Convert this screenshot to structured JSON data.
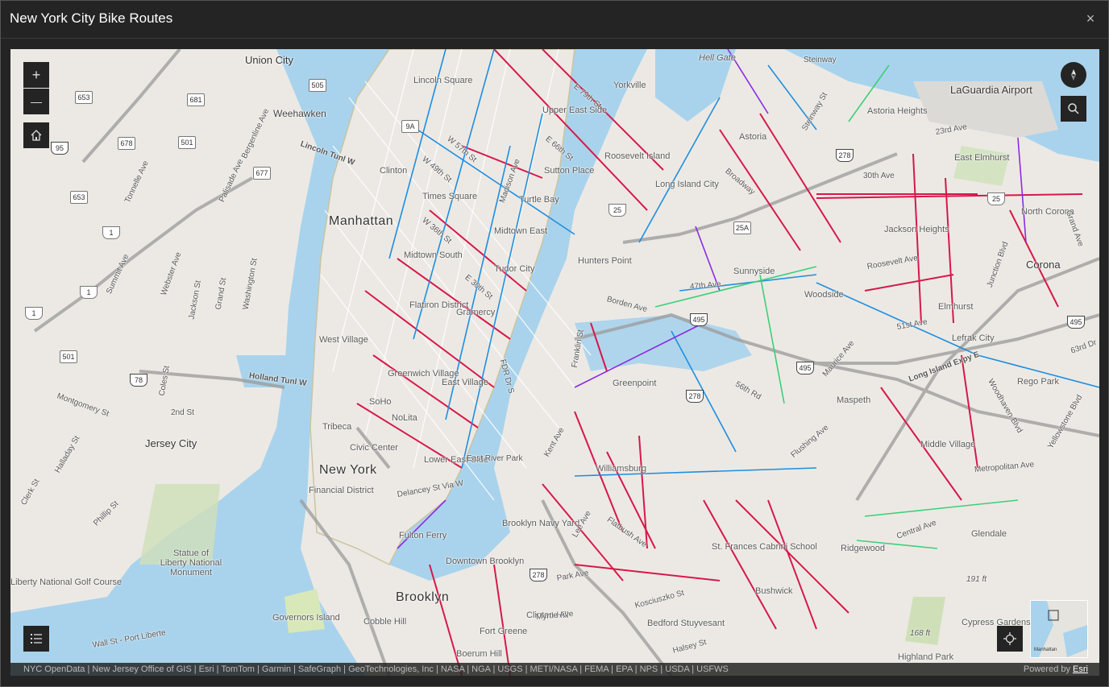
{
  "window": {
    "title": "New York City Bike Routes"
  },
  "controls": {
    "zoom_in": "+",
    "zoom_out": "—",
    "close": "×"
  },
  "labels": {
    "boroughs": [
      "Manhattan",
      "New York",
      "Brooklyn",
      "Jersey City"
    ],
    "neighborhoods": [
      "Union City",
      "Weehawken",
      "Lincoln Square",
      "Yorkville",
      "Upper East Side",
      "Clinton",
      "Times Square",
      "Turtle Bay",
      "Sutton Place",
      "Midtown East",
      "Midtown South",
      "Tudor City",
      "Roosevelt Island",
      "Long Island City",
      "Hunters Point",
      "Astoria",
      "Astoria Heights",
      "LaGuardia Airport",
      "East Elmhurst",
      "Jackson Heights",
      "North Corona",
      "Corona",
      "Sunnyside",
      "Woodside",
      "Elmhurst",
      "Lefrak City",
      "Rego Park",
      "Maspeth",
      "Middle Village",
      "Glendale",
      "Ridgewood",
      "Bushwick",
      "Williamsburg",
      "Greenpoint",
      "Flatiron District",
      "Gramercy",
      "West Village",
      "Greenwich Village",
      "East Village",
      "SoHo",
      "NoLita",
      "Tribeca",
      "Civic Center",
      "Lower East Side",
      "Financial District",
      "Downtown Brooklyn",
      "Brooklyn Navy Yard",
      "Fulton Ferry",
      "Cobble Hill",
      "Fort Greene",
      "Clinton Hill",
      "Boerum Hill",
      "Bedford Stuyvesant",
      "St. Frances Cabrini School",
      "Cypress Gardens",
      "Highland Park",
      "Statue of Liberty National Monument",
      "Liberty National Golf Course",
      "Governors Island",
      "Hell Gate"
    ],
    "roads": [
      "Lincoln Tunl W",
      "Holland Tunl W",
      "Tonnelle Ave",
      "Palisade Ave",
      "Bergenline Ave",
      "Summit Ave",
      "Webster Ave",
      "Jackson St",
      "Grand St",
      "Washington St",
      "Montgomery St",
      "Coles St",
      "2nd St",
      "Halladay St",
      "Clerk St",
      "Phillip St",
      "Wall St - Port Liberte",
      "W 49th St",
      "W 36th St",
      "W 57th St",
      "E 79th St",
      "E 66th St",
      "E 30th St",
      "Madison Ave",
      "FDR Dr S",
      "Borden Ave",
      "47th Ave",
      "Broadway",
      "Steinway St",
      "30th Ave",
      "23rd Ave",
      "Roosevelt Ave",
      "Long Island Expy E",
      "Woodhaven Blvd",
      "Junction Blvd",
      "Metropolitan Ave",
      "Flushing Ave",
      "Kosciuszko St",
      "Myrtle Ave",
      "Halsey St",
      "Central Ave",
      "Grand Ave",
      "Maurice Ave",
      "51st Ave",
      "56th Rd",
      "Flatbush Ave",
      "Park Ave",
      "Lee Ave",
      "Kent Ave",
      "Franklin St",
      "Delancey St Via W",
      "Steinway",
      "East River Park",
      "Yellowstone Blvd",
      "63rd Dr"
    ],
    "elevation": [
      "191 ft",
      "168 ft"
    ],
    "highway_shields": [
      "495",
      "278",
      "25",
      "25A",
      "9A",
      "1",
      "95",
      "78",
      "653",
      "681",
      "505",
      "501",
      "678",
      "677"
    ]
  },
  "overview_map": {
    "label": "Manhattan"
  },
  "attribution": "NYC OpenData | New Jersey Office of GIS | Esri | TomTom | Garmin | SafeGraph | GeoTechnologies, Inc | NASA | NGA | USGS | METI/NASA | FEMA | EPA | NPS | USDA | USFWS",
  "powered_by": {
    "prefix": "Powered by ",
    "link": "Esri"
  },
  "colors": {
    "water": "#a9d3ec",
    "land": "#ece9e4",
    "park": "#cfe0b9",
    "route_protected": "#d6184a",
    "route_lane": "#1e8ee0",
    "route_shared": "#8a2be2",
    "route_green": "#3ccf7a"
  }
}
